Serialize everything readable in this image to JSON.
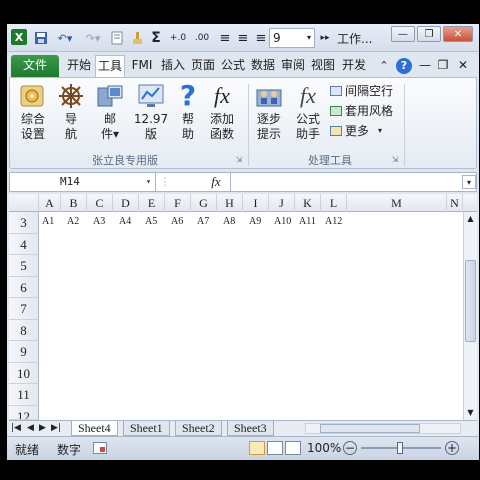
{
  "qat": {
    "font_size": "9",
    "title": "工作...",
    "sigma": "Σ"
  },
  "tabs": [
    "文件",
    "开始",
    "工具",
    "FMI",
    "插入",
    "页面",
    "公式",
    "数据",
    "审阅",
    "视图",
    "开发"
  ],
  "ribbon": {
    "group1": {
      "label": "张立良专用版",
      "buttons": [
        {
          "line1": "综合",
          "line2": "设置"
        },
        {
          "line1": "导",
          "line2": "航"
        },
        {
          "line1": "邮",
          "line2": "件▾"
        },
        {
          "line1": "12.97",
          "line2": "版"
        },
        {
          "line1": "帮",
          "line2": "助"
        },
        {
          "line1": "添加",
          "line2": "函数"
        }
      ]
    },
    "group2": {
      "label": "处理工具",
      "buttons": [
        {
          "line1": "逐步",
          "line2": "提示"
        },
        {
          "line1": "公式",
          "line2": "助手"
        }
      ],
      "small": [
        "间隔空行",
        "套用风格",
        "更多"
      ]
    }
  },
  "formula_bar": {
    "name_box": "M14",
    "fx": "fx",
    "value": ""
  },
  "columns": [
    "A",
    "B",
    "C",
    "D",
    "E",
    "F",
    "G",
    "H",
    "I",
    "J",
    "K",
    "L",
    "M",
    "N"
  ],
  "rows": [
    "3",
    "4",
    "5",
    "6",
    "7",
    "8",
    "9",
    "10",
    "11",
    "12"
  ],
  "row3_cells": [
    "A1",
    "A2",
    "A3",
    "A4",
    "A5",
    "A6",
    "A7",
    "A8",
    "A9",
    "A10",
    "A11",
    "A12"
  ],
  "sheets": [
    "Sheet4",
    "Sheet1",
    "Sheet2",
    "Sheet3"
  ],
  "status": {
    "ready": "就绪",
    "mode": "数字",
    "zoom": "100%"
  },
  "colors": {
    "file_tab": "#2a8a3a",
    "ribbon_bg": "#f4f7fb",
    "help_blue": "#2b6fd6"
  }
}
